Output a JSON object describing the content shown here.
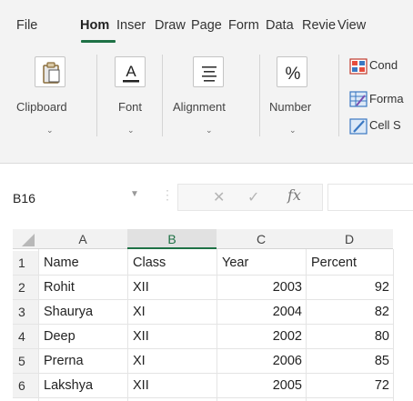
{
  "menu": {
    "tabs": [
      {
        "label": "File"
      },
      {
        "label": "Hom"
      },
      {
        "label": "Inser"
      },
      {
        "label": "Draw"
      },
      {
        "label": "Page"
      },
      {
        "label": "Form"
      },
      {
        "label": "Data"
      },
      {
        "label": "Revie"
      },
      {
        "label": "View"
      }
    ],
    "active_tab_index": 1
  },
  "ribbon": {
    "groups": [
      {
        "label": "Clipboard",
        "icon": "clipboard-icon"
      },
      {
        "label": "Font",
        "icon": "font-color-icon"
      },
      {
        "label": "Alignment",
        "icon": "align-icon"
      },
      {
        "label": "Number",
        "icon": "percent-icon",
        "glyph": "%"
      }
    ],
    "styles_commands": [
      {
        "label": "Cond",
        "icon": "conditional-formatting-icon"
      },
      {
        "label": "Forma",
        "icon": "format-as-table-icon"
      },
      {
        "label": "Cell S",
        "icon": "cell-styles-icon"
      }
    ]
  },
  "formula_bar": {
    "name_box": "B16",
    "fx_label": "fx",
    "value": ""
  },
  "sheet": {
    "columns": [
      "A",
      "B",
      "C",
      "D"
    ],
    "selected_column": "B",
    "rows": [
      {
        "n": "1",
        "cells": [
          "Name",
          "Class",
          "Year",
          "Percent"
        ]
      },
      {
        "n": "2",
        "cells": [
          "Rohit",
          "XII",
          "2003",
          "92"
        ]
      },
      {
        "n": "3",
        "cells": [
          "Shaurya",
          "XI",
          "2004",
          "82"
        ]
      },
      {
        "n": "4",
        "cells": [
          "Deep",
          "XII",
          "2002",
          "80"
        ]
      },
      {
        "n": "5",
        "cells": [
          "Prerna",
          "XI",
          "2006",
          "85"
        ]
      },
      {
        "n": "6",
        "cells": [
          "Lakshya",
          "XII",
          "2005",
          "72"
        ]
      }
    ]
  },
  "colors": {
    "accent": "#1e7145",
    "ribbon_bg": "#f3f3f3"
  }
}
